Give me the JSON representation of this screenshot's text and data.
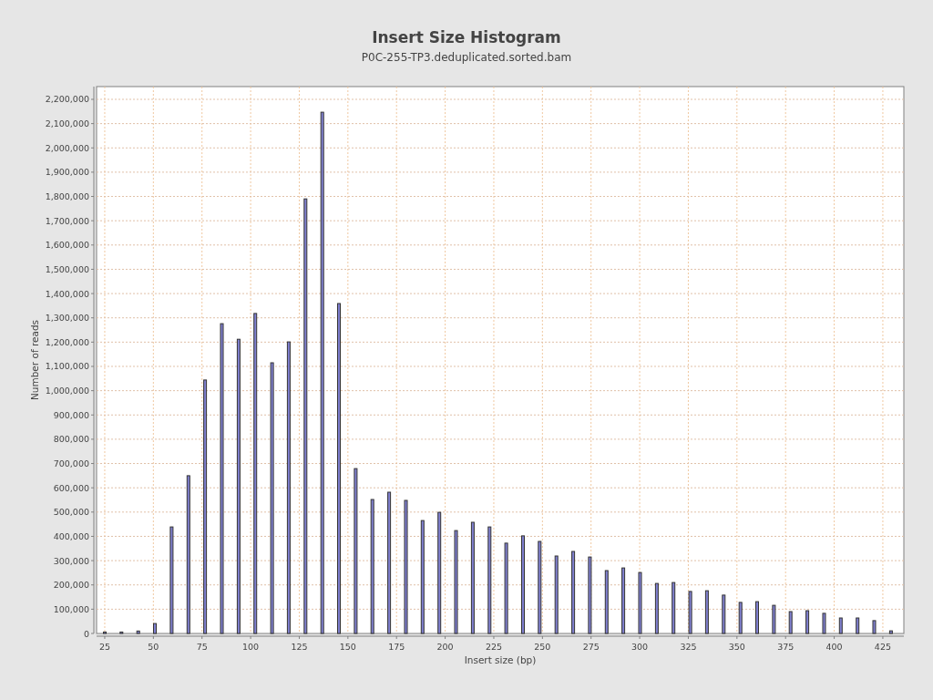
{
  "title": "Insert Size Histogram",
  "subtitle": "P0C-255-TP3.deduplicated.sorted.bam",
  "chart_data": {
    "type": "bar",
    "xlabel": "Insert size (bp)",
    "ylabel": "Number of reads",
    "x": [
      25,
      33.6,
      42.2,
      50.8,
      59.4,
      68,
      76.6,
      85.2,
      93.8,
      102.4,
      111,
      119.6,
      128.2,
      136.8,
      145.4,
      154,
      162.6,
      171.2,
      179.8,
      188.4,
      197,
      205.6,
      214.2,
      222.8,
      231.4,
      240,
      248.6,
      257.2,
      265.8,
      274.4,
      283,
      291.6,
      300.2,
      308.8,
      317.4,
      326,
      334.6,
      343.2,
      351.8,
      360.4,
      369,
      377.6,
      386.2,
      394.8,
      403.4,
      412,
      420.6,
      429.2
    ],
    "grid": true,
    "series": [
      {
        "color": "#8080d0",
        "values": [
          6000,
          6000,
          10000,
          41000,
          439000,
          650000,
          1044000,
          1276000,
          1212000,
          1318000,
          1115000,
          1201000,
          1790000,
          2147000,
          1359000,
          679000,
          552000,
          582000,
          548000,
          465000,
          499000,
          424000,
          458000,
          439000,
          372000,
          402000,
          379000,
          319000,
          338000,
          315000,
          259000,
          270000,
          251000,
          206000,
          210000,
          173000,
          176000,
          158000,
          128000,
          131000,
          116000,
          90000,
          94000,
          83000,
          64000,
          64000,
          53000,
          11000
        ]
      }
    ],
    "xlim": [
      20.8,
      435.8
    ],
    "ylim": [
      0,
      2252500
    ],
    "xticks": [
      25,
      50,
      75,
      100,
      125,
      150,
      175,
      200,
      225,
      250,
      275,
      300,
      325,
      350,
      375,
      400,
      425
    ],
    "yticks": [
      {
        "value": 0,
        "label": "0"
      },
      {
        "value": 100000,
        "label": "100,000"
      },
      {
        "value": 200000,
        "label": "200,000"
      },
      {
        "value": 300000,
        "label": "300,000"
      },
      {
        "value": 400000,
        "label": "400,000"
      },
      {
        "value": 500000,
        "label": "500,000"
      },
      {
        "value": 600000,
        "label": "600,000"
      },
      {
        "value": 700000,
        "label": "700,000"
      },
      {
        "value": 800000,
        "label": "800,000"
      },
      {
        "value": 900000,
        "label": "900,000"
      },
      {
        "value": 1000000,
        "label": "1,000,000"
      },
      {
        "value": 1100000,
        "label": "1,100,000"
      },
      {
        "value": 1200000,
        "label": "1,200,000"
      },
      {
        "value": 1300000,
        "label": "1,300,000"
      },
      {
        "value": 1400000,
        "label": "1,400,000"
      },
      {
        "value": 1500000,
        "label": "1,500,000"
      },
      {
        "value": 1600000,
        "label": "1,600,000"
      },
      {
        "value": 1700000,
        "label": "1,700,000"
      },
      {
        "value": 1800000,
        "label": "1,800,000"
      },
      {
        "value": 1900000,
        "label": "1,900,000"
      },
      {
        "value": 2000000,
        "label": "2,000,000"
      },
      {
        "value": 2100000,
        "label": "2,100,000"
      },
      {
        "value": 2200000,
        "label": "2,200,000"
      }
    ]
  }
}
